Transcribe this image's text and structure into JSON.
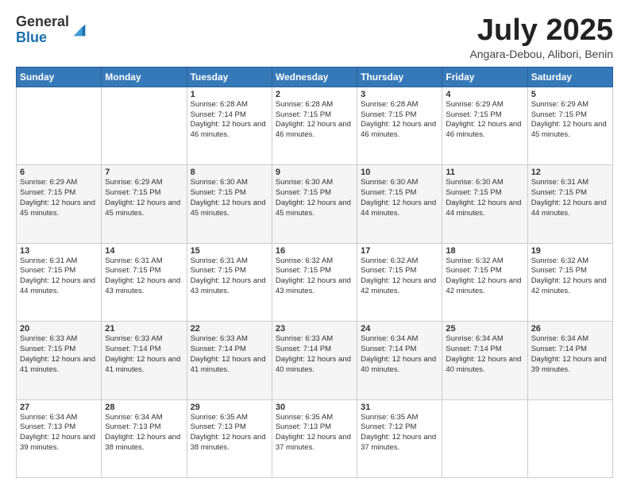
{
  "header": {
    "logo_general": "General",
    "logo_blue": "Blue",
    "month": "July 2025",
    "location": "Angara-Debou, Alibori, Benin"
  },
  "days_of_week": [
    "Sunday",
    "Monday",
    "Tuesday",
    "Wednesday",
    "Thursday",
    "Friday",
    "Saturday"
  ],
  "weeks": [
    [
      {
        "day": "",
        "info": ""
      },
      {
        "day": "",
        "info": ""
      },
      {
        "day": "1",
        "info": "Sunrise: 6:28 AM\nSunset: 7:14 PM\nDaylight: 12 hours and 46 minutes."
      },
      {
        "day": "2",
        "info": "Sunrise: 6:28 AM\nSunset: 7:15 PM\nDaylight: 12 hours and 46 minutes."
      },
      {
        "day": "3",
        "info": "Sunrise: 6:28 AM\nSunset: 7:15 PM\nDaylight: 12 hours and 46 minutes."
      },
      {
        "day": "4",
        "info": "Sunrise: 6:29 AM\nSunset: 7:15 PM\nDaylight: 12 hours and 46 minutes."
      },
      {
        "day": "5",
        "info": "Sunrise: 6:29 AM\nSunset: 7:15 PM\nDaylight: 12 hours and 45 minutes."
      }
    ],
    [
      {
        "day": "6",
        "info": "Sunrise: 6:29 AM\nSunset: 7:15 PM\nDaylight: 12 hours and 45 minutes."
      },
      {
        "day": "7",
        "info": "Sunrise: 6:29 AM\nSunset: 7:15 PM\nDaylight: 12 hours and 45 minutes."
      },
      {
        "day": "8",
        "info": "Sunrise: 6:30 AM\nSunset: 7:15 PM\nDaylight: 12 hours and 45 minutes."
      },
      {
        "day": "9",
        "info": "Sunrise: 6:30 AM\nSunset: 7:15 PM\nDaylight: 12 hours and 45 minutes."
      },
      {
        "day": "10",
        "info": "Sunrise: 6:30 AM\nSunset: 7:15 PM\nDaylight: 12 hours and 44 minutes."
      },
      {
        "day": "11",
        "info": "Sunrise: 6:30 AM\nSunset: 7:15 PM\nDaylight: 12 hours and 44 minutes."
      },
      {
        "day": "12",
        "info": "Sunrise: 6:31 AM\nSunset: 7:15 PM\nDaylight: 12 hours and 44 minutes."
      }
    ],
    [
      {
        "day": "13",
        "info": "Sunrise: 6:31 AM\nSunset: 7:15 PM\nDaylight: 12 hours and 44 minutes."
      },
      {
        "day": "14",
        "info": "Sunrise: 6:31 AM\nSunset: 7:15 PM\nDaylight: 12 hours and 43 minutes."
      },
      {
        "day": "15",
        "info": "Sunrise: 6:31 AM\nSunset: 7:15 PM\nDaylight: 12 hours and 43 minutes."
      },
      {
        "day": "16",
        "info": "Sunrise: 6:32 AM\nSunset: 7:15 PM\nDaylight: 12 hours and 43 minutes."
      },
      {
        "day": "17",
        "info": "Sunrise: 6:32 AM\nSunset: 7:15 PM\nDaylight: 12 hours and 42 minutes."
      },
      {
        "day": "18",
        "info": "Sunrise: 6:32 AM\nSunset: 7:15 PM\nDaylight: 12 hours and 42 minutes."
      },
      {
        "day": "19",
        "info": "Sunrise: 6:32 AM\nSunset: 7:15 PM\nDaylight: 12 hours and 42 minutes."
      }
    ],
    [
      {
        "day": "20",
        "info": "Sunrise: 6:33 AM\nSunset: 7:15 PM\nDaylight: 12 hours and 41 minutes."
      },
      {
        "day": "21",
        "info": "Sunrise: 6:33 AM\nSunset: 7:14 PM\nDaylight: 12 hours and 41 minutes."
      },
      {
        "day": "22",
        "info": "Sunrise: 6:33 AM\nSunset: 7:14 PM\nDaylight: 12 hours and 41 minutes."
      },
      {
        "day": "23",
        "info": "Sunrise: 6:33 AM\nSunset: 7:14 PM\nDaylight: 12 hours and 40 minutes."
      },
      {
        "day": "24",
        "info": "Sunrise: 6:34 AM\nSunset: 7:14 PM\nDaylight: 12 hours and 40 minutes."
      },
      {
        "day": "25",
        "info": "Sunrise: 6:34 AM\nSunset: 7:14 PM\nDaylight: 12 hours and 40 minutes."
      },
      {
        "day": "26",
        "info": "Sunrise: 6:34 AM\nSunset: 7:14 PM\nDaylight: 12 hours and 39 minutes."
      }
    ],
    [
      {
        "day": "27",
        "info": "Sunrise: 6:34 AM\nSunset: 7:13 PM\nDaylight: 12 hours and 39 minutes."
      },
      {
        "day": "28",
        "info": "Sunrise: 6:34 AM\nSunset: 7:13 PM\nDaylight: 12 hours and 38 minutes."
      },
      {
        "day": "29",
        "info": "Sunrise: 6:35 AM\nSunset: 7:13 PM\nDaylight: 12 hours and 38 minutes."
      },
      {
        "day": "30",
        "info": "Sunrise: 6:35 AM\nSunset: 7:13 PM\nDaylight: 12 hours and 37 minutes."
      },
      {
        "day": "31",
        "info": "Sunrise: 6:35 AM\nSunset: 7:12 PM\nDaylight: 12 hours and 37 minutes."
      },
      {
        "day": "",
        "info": ""
      },
      {
        "day": "",
        "info": ""
      }
    ]
  ]
}
